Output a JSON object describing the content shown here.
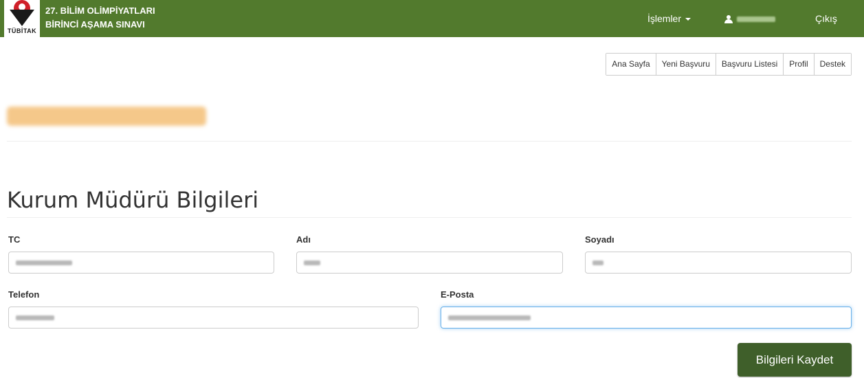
{
  "header": {
    "brand_line1": "27. BİLİM OLİMPİYATLARI",
    "brand_line2": "BİRİNCİ AŞAMA SINAVI",
    "logo_text": "TÜBİTAK",
    "menu_label": "İşlemler",
    "user_name": "",
    "logout_label": "Çıkış",
    "bar_color": "#527a2d"
  },
  "subnav": {
    "items": [
      "Ana Sayfa",
      "Yeni Başvuru",
      "Başvuru Listesi",
      "Profil",
      "Destek"
    ]
  },
  "org_name": "",
  "form": {
    "title": "Kurum Müdürü Bilgileri",
    "fields": {
      "tc": {
        "label": "TC",
        "value": ""
      },
      "adi": {
        "label": "Adı",
        "value": ""
      },
      "soyadi": {
        "label": "Soyadı",
        "value": ""
      },
      "telefon": {
        "label": "Telefon",
        "value": ""
      },
      "eposta": {
        "label": "E-Posta",
        "value": ""
      }
    },
    "save_label": "Bilgileri Kaydet",
    "save_color": "#3f5f2a"
  }
}
